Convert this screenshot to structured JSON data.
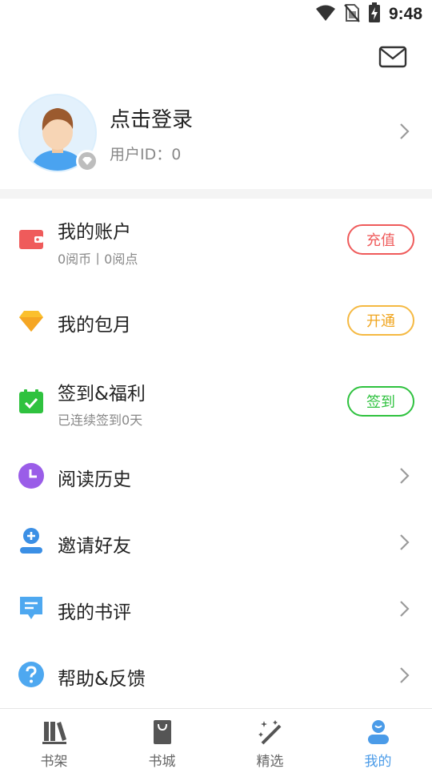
{
  "status_bar": {
    "time": "9:48"
  },
  "header": {
    "mail_icon": "mail-icon"
  },
  "profile": {
    "name": "点击登录",
    "user_id": "用户ID：0"
  },
  "menu": [
    {
      "key": "account",
      "title": "我的账户",
      "subtitle": "0阅币丨0阅点",
      "button": "充值",
      "icon": "wallet-icon",
      "accent": "#ef5b5b"
    },
    {
      "key": "monthly",
      "title": "我的包月",
      "button": "开通",
      "icon": "diamond-icon",
      "accent": "#f5b942"
    },
    {
      "key": "checkin",
      "title": "签到&福利",
      "subtitle": "已连续签到0天",
      "button": "签到",
      "icon": "calendar-check-icon",
      "accent": "#2fc23f"
    },
    {
      "key": "history",
      "title": "阅读历史",
      "icon": "clock-icon",
      "accent": "#9a5de8"
    },
    {
      "key": "invite",
      "title": "邀请好友",
      "icon": "add-user-icon",
      "accent": "#3b8fe5"
    },
    {
      "key": "reviews",
      "title": "我的书评",
      "icon": "comment-icon",
      "accent": "#4ea8f0"
    },
    {
      "key": "help",
      "title": "帮助&反馈",
      "icon": "help-icon",
      "accent": "#4ea8f0"
    }
  ],
  "tabs": [
    {
      "label": "书架",
      "icon": "bookshelf-icon",
      "active": false
    },
    {
      "label": "书城",
      "icon": "bookstore-icon",
      "active": false
    },
    {
      "label": "精选",
      "icon": "magic-wand-icon",
      "active": false
    },
    {
      "label": "我的",
      "icon": "profile-icon",
      "active": true
    }
  ],
  "colors": {
    "active_tab": "#4a9be8",
    "divider": "#f4f4f4"
  }
}
